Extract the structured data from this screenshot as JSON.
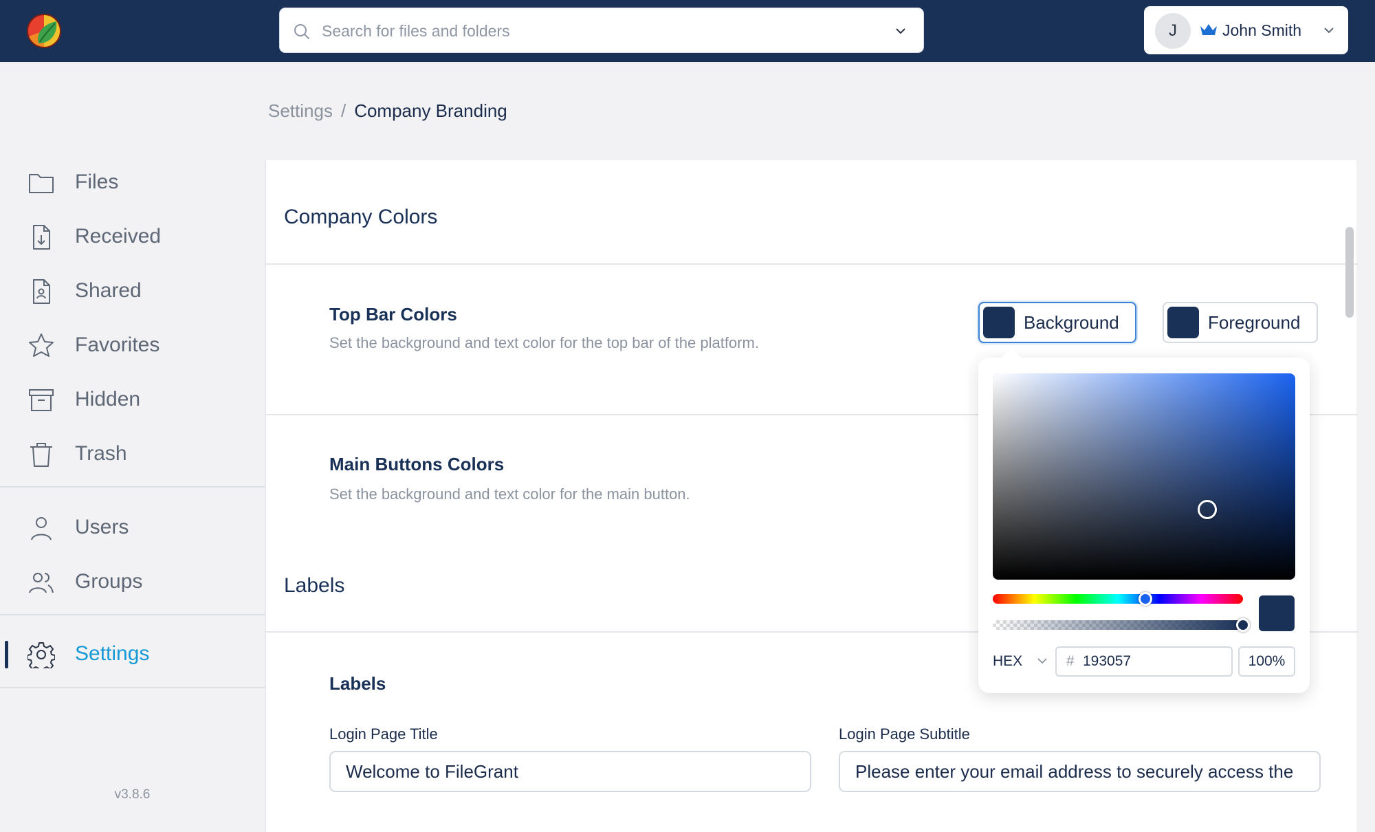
{
  "topbar": {
    "background_color": "#193057",
    "logo_icon": "filegrant-logo",
    "search": {
      "placeholder": "Search for files and folders",
      "icon": "search-icon"
    },
    "user": {
      "initial": "J",
      "name": "John Smith",
      "badge_icon": "crown-icon"
    }
  },
  "sidebar": {
    "items": [
      {
        "label": "Files",
        "icon": "folder-icon"
      },
      {
        "label": "Received",
        "icon": "file-download-icon"
      },
      {
        "label": "Shared",
        "icon": "file-user-icon"
      },
      {
        "label": "Favorites",
        "icon": "star-icon"
      },
      {
        "label": "Hidden",
        "icon": "archive-icon"
      },
      {
        "label": "Trash",
        "icon": "trash-icon"
      },
      {
        "label": "Users",
        "icon": "user-icon"
      },
      {
        "label": "Groups",
        "icon": "users-icon"
      },
      {
        "label": "Settings",
        "icon": "gear-icon",
        "active": true
      }
    ],
    "version": "v3.8.6",
    "active_color": "#1799d6"
  },
  "breadcrumb": {
    "parent": "Settings",
    "separator": "/",
    "current": "Company Branding"
  },
  "sections": {
    "company_colors": {
      "title": "Company Colors",
      "top_bar": {
        "title": "Top Bar Colors",
        "description": "Set the background and text color for the top bar of the platform.",
        "background_label": "Background",
        "foreground_label": "Foreground"
      },
      "main_buttons": {
        "title": "Main Buttons Colors",
        "description": "Set the background and text color for the main button."
      }
    },
    "labels": {
      "title": "Labels",
      "subsection_title": "Labels",
      "login_title_label": "Login Page Title",
      "login_title_value": "Welcome to FileGrant",
      "login_subtitle_label": "Login Page Subtitle",
      "login_subtitle_value": "Please enter your email address to securely access the"
    }
  },
  "color_picker": {
    "format": "HEX",
    "hex_value": "193057",
    "opacity": "100%",
    "selected_color": "#193057",
    "hue_color": "#1a63f0",
    "hue_fraction": 0.61,
    "saturation_fraction": 0.71,
    "brightness_fraction": 0.34,
    "alpha_fraction": 1.0
  }
}
